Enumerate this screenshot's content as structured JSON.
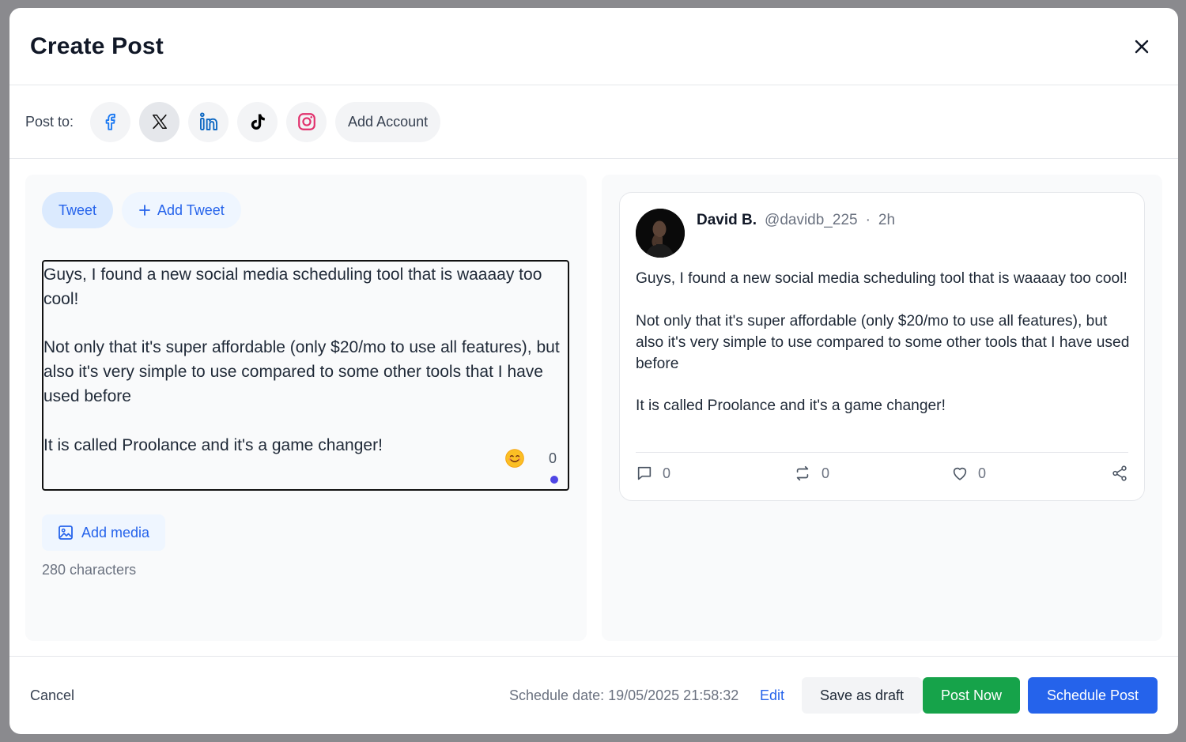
{
  "modal": {
    "title": "Create Post",
    "close_icon": "close-icon"
  },
  "post_to": {
    "label": "Post to:",
    "accounts": [
      {
        "name": "facebook",
        "icon": "facebook-icon",
        "color": "#1877f2"
      },
      {
        "name": "x",
        "icon": "x-icon",
        "color": "#111111",
        "selected": true
      },
      {
        "name": "linkedin",
        "icon": "linkedin-icon",
        "color": "#0a66c2"
      },
      {
        "name": "tiktok",
        "icon": "tiktok-icon",
        "color": "#000000"
      },
      {
        "name": "instagram",
        "icon": "instagram-icon",
        "color": "#e1306c"
      }
    ],
    "add_account_label": "Add Account"
  },
  "editor": {
    "tab_active": "Tweet",
    "tab_add": "Add Tweet",
    "text": "Guys, I found a new social media scheduling tool that is waaaay too cool!\n\nNot only that it's super affordable (only $20/mo to use all features), but also it's very simple to use compared to some other tools that I have used before\n\nIt is called Proolance and it's a game changer!",
    "emoji_icon": "smile-emoji-icon",
    "char_count": "0",
    "add_media_label": "Add media",
    "char_limit": "280 characters"
  },
  "preview": {
    "author": "David B.",
    "handle": "@davidb_225",
    "separator": "·",
    "time": "2h",
    "text": "Guys, I found a new social media scheduling tool that is waaaay too cool!\n\nNot only that it's super affordable (only $20/mo to use all features), but also it's very simple to use compared to some other tools that I have used before\n\nIt is called Proolance and it's a game changer!",
    "replies": "0",
    "retweets": "0",
    "likes": "0"
  },
  "footer": {
    "cancel_label": "Cancel",
    "schedule_date": "Schedule date: 19/05/2025 21:58:32",
    "edit_label": "Edit",
    "draft_label": "Save as draft",
    "post_now_label": "Post Now",
    "schedule_label": "Schedule Post"
  },
  "colors": {
    "primary": "#2563eb",
    "success": "#16a34a",
    "status_dot": "#4f46e5"
  }
}
